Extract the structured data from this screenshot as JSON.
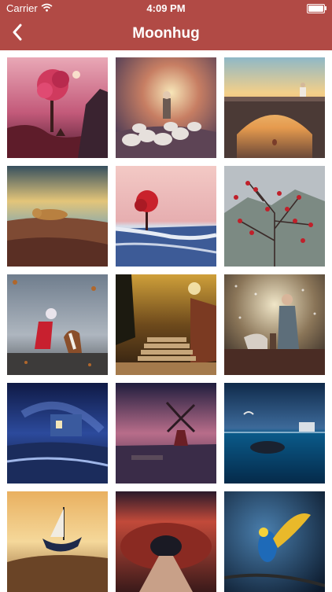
{
  "status_bar": {
    "carrier": "Carrier",
    "time": "4:09 PM"
  },
  "navbar": {
    "title": "Moonhug",
    "back_icon": "chevron-left-icon",
    "color": "#b14a45"
  },
  "gallery": {
    "items": [
      {
        "name": "tile-pink-tree-deer"
      },
      {
        "name": "tile-sheep-herd"
      },
      {
        "name": "tile-stone-bridge"
      },
      {
        "name": "tile-lion-landscape"
      },
      {
        "name": "tile-red-tree-snow"
      },
      {
        "name": "tile-red-berries-branches"
      },
      {
        "name": "tile-girl-with-dog"
      },
      {
        "name": "tile-stairway-ruins"
      },
      {
        "name": "tile-woman-with-horse"
      },
      {
        "name": "tile-blue-cabin"
      },
      {
        "name": "tile-windmill"
      },
      {
        "name": "tile-underwater-whale"
      },
      {
        "name": "tile-flying-boat"
      },
      {
        "name": "tile-red-tunnel"
      },
      {
        "name": "tile-parrot"
      }
    ]
  }
}
